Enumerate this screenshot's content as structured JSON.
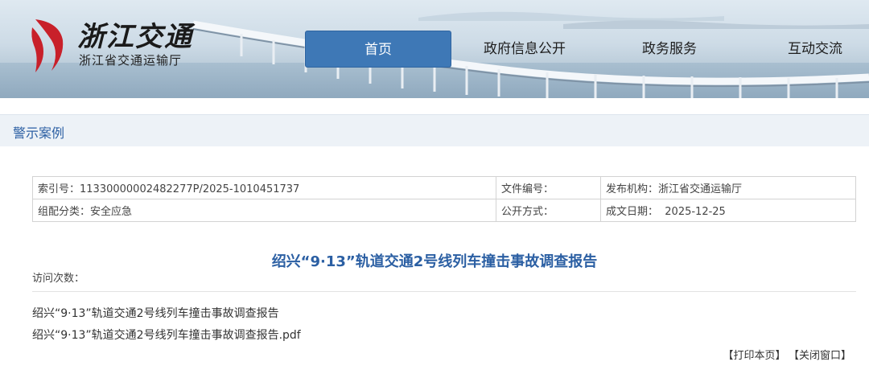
{
  "header": {
    "logo_text": "浙江交通",
    "logo_subtitle": "浙江省交通运输厅"
  },
  "nav": {
    "items": [
      {
        "label": "首页",
        "active": true
      },
      {
        "label": "政府信息公开",
        "active": false
      },
      {
        "label": "政务服务",
        "active": false
      },
      {
        "label": "互动交流",
        "active": false
      }
    ]
  },
  "section": {
    "title": "警示案例"
  },
  "meta": {
    "index_label": "索引号：",
    "index_value": "11330000002482277P/2025-1010451737",
    "doc_no_label": "文件编号：",
    "doc_no_value": "",
    "publisher_label": "发布机构：",
    "publisher_value": "浙江省交通运输厅",
    "category_label": "组配分类：",
    "category_value": "安全应急",
    "disclosure_label": "公开方式：",
    "disclosure_value": "",
    "date_label": "成文日期：",
    "date_value": "2025-12-25"
  },
  "document": {
    "title": "绍兴“9·13”轨道交通2号线列车撞击事故调查报告",
    "visits_label": "访问次数："
  },
  "attachments": [
    "绍兴“9·13”轨道交通2号线列车撞击事故调查报告",
    "绍兴“9·13”轨道交通2号线列车撞击事故调查报告.pdf"
  ],
  "footer": {
    "print_label": "【打印本页】",
    "close_label": "【关闭窗口】"
  },
  "colors": {
    "accent": "#3e78b6",
    "title_blue": "#2b5fa3",
    "logo_red": "#c8202a"
  }
}
